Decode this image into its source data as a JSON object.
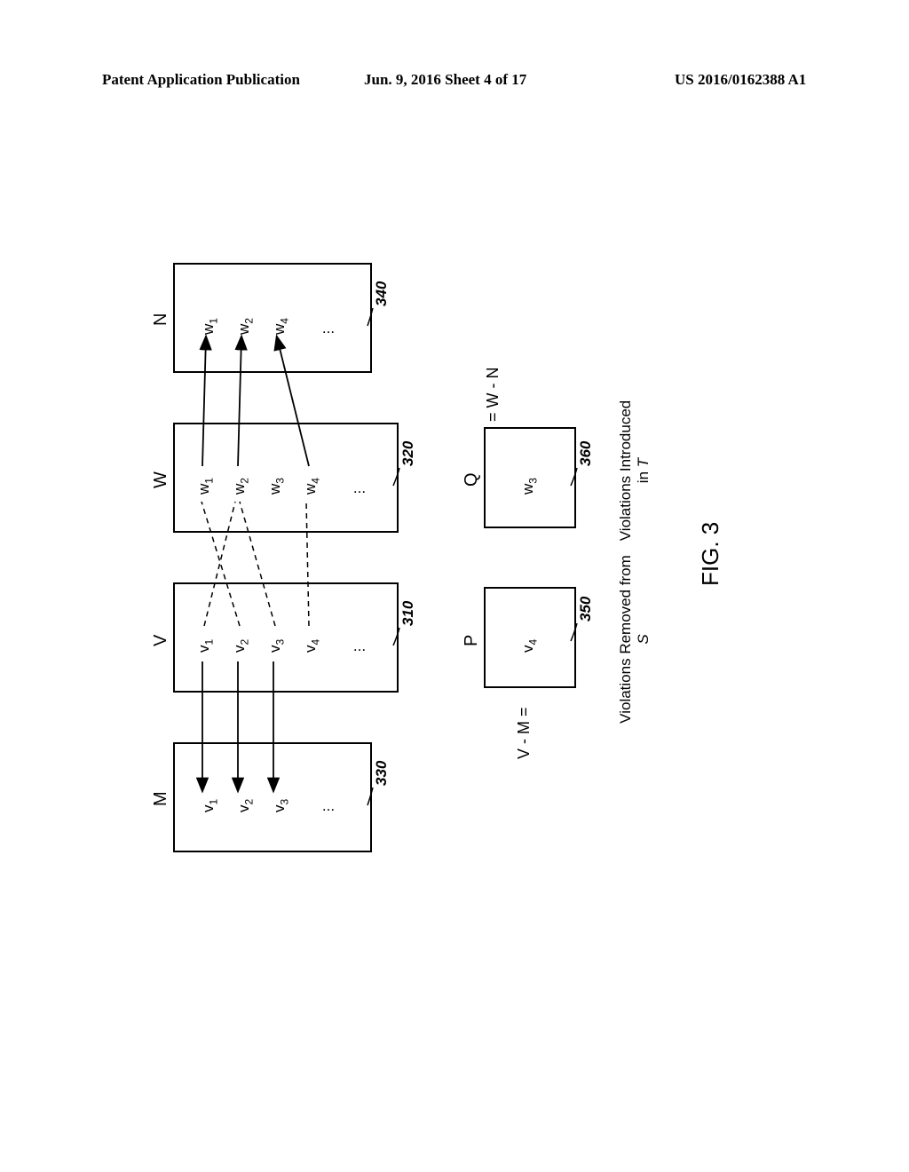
{
  "header": {
    "left": "Patent Application Publication",
    "center": "Jun. 9, 2016  Sheet 4 of 17",
    "right": "US 2016/0162388 A1"
  },
  "diagram": {
    "boxes": {
      "M": {
        "label": "M",
        "ref": "330",
        "items": [
          "v1",
          "v2",
          "v3",
          "..."
        ]
      },
      "V": {
        "label": "V",
        "ref": "310",
        "items": [
          "v1",
          "v2",
          "v3",
          "v4",
          "..."
        ]
      },
      "W": {
        "label": "W",
        "ref": "320",
        "items": [
          "w1",
          "w2",
          "w3",
          "w4",
          "..."
        ]
      },
      "N": {
        "label": "N",
        "ref": "340",
        "items": [
          "w1",
          "w2",
          "w4",
          "..."
        ]
      },
      "P": {
        "label": "P",
        "ref": "350",
        "items": [
          "v4"
        ]
      },
      "Q": {
        "label": "Q",
        "ref": "360",
        "items": [
          "w3"
        ]
      }
    },
    "equations": {
      "p": "V - M =",
      "q": "= W - N"
    },
    "captions": {
      "p": "Violations Removed from S",
      "q": "Violations Introduced in T"
    },
    "figure": "FIG. 3"
  }
}
